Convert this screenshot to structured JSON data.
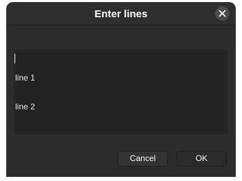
{
  "dialog": {
    "title": "Enter lines",
    "close_icon": "close-icon"
  },
  "editor": {
    "lines": [
      "line 1",
      "line 2"
    ]
  },
  "buttons": {
    "cancel_label": "Cancel",
    "ok_label": "OK"
  },
  "colors": {
    "dialog_background": "#2c2c2c",
    "text_area_background": "#222222",
    "text": "#ffffff"
  }
}
